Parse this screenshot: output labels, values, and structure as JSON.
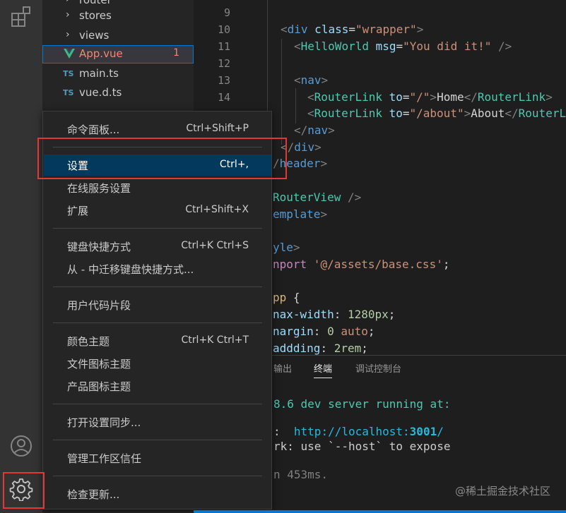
{
  "sidebar": {
    "items": [
      {
        "label": "router",
        "type": "folder"
      },
      {
        "label": "stores",
        "type": "folder"
      },
      {
        "label": "views",
        "type": "folder"
      },
      {
        "label": "App.vue",
        "type": "vue",
        "badge": "1"
      },
      {
        "label": "main.ts",
        "type": "ts",
        "icon_text": "TS"
      },
      {
        "label": "vue.d.ts",
        "type": "ts",
        "icon_text": "TS"
      }
    ]
  },
  "editor": {
    "line_numbers": [
      "9",
      "10",
      "11",
      "12",
      "13",
      "14"
    ],
    "code": {
      "l10": {
        "open": "<",
        "tag": "div",
        "attr": " class",
        "eq": "=",
        "str": "\"wrapper\"",
        "close": ">"
      },
      "l11": {
        "open": "<",
        "tag": "HelloWorld",
        "attr": " msg",
        "eq": "=",
        "str": "\"You did it!\"",
        "close": " />"
      },
      "l13": {
        "open": "<",
        "tag": "nav",
        "close": ">"
      },
      "l14": {
        "open": "<",
        "tag": "RouterLink",
        "attr": " to",
        "eq": "=",
        "str": "\"/\"",
        "gt": ">",
        "text": "Home",
        "endopen": "</",
        "endtag": "RouterLink",
        "endclose": ">"
      },
      "l15": {
        "open": "<",
        "tag": "RouterLink",
        "attr": " to",
        "eq": "=",
        "str": "\"/about\"",
        "gt": ">",
        "text": "About",
        "endopen": "</",
        "endtag": "RouterL"
      },
      "l16": {
        "open": "</",
        "tag": "nav",
        "close": ">"
      },
      "l17": {
        "open": "</",
        "tag": "div",
        "close": ">"
      },
      "l18": {
        "open": "/",
        "tag": "header",
        "close": ">"
      },
      "l20": {
        "comp": "RouterView",
        "close": " />"
      },
      "l21": {
        "tag": "emplate",
        "close": ">"
      },
      "l23": {
        "tag": "yle",
        "close": ">"
      },
      "l24": {
        "kw": "nport",
        "str": " '@/assets/base.css'",
        "semi": ";"
      },
      "l26": {
        "sel": "pp",
        "brace": " {"
      },
      "l27": {
        "prop": "nax-width",
        "colon": ": ",
        "num": "1280px",
        "semi": ";"
      },
      "l28": {
        "prop": "nargin",
        "colon": ": ",
        "num": "0",
        "val": " auto",
        "semi": ";"
      },
      "l29": {
        "prop": "addding",
        "colon": ": ",
        "num": "2rem",
        "semi": ";"
      }
    }
  },
  "panel": {
    "tabs": [
      {
        "label": "输出",
        "active": false
      },
      {
        "label": "终端",
        "active": true
      },
      {
        "label": "调试控制台",
        "active": false
      }
    ],
    "terminal": {
      "line1": "8.6 dev server running at:",
      "line2_prefix": ":  ",
      "line2_url": "http://localhost:",
      "line2_port": "3001",
      "line2_slash": "/",
      "line3": "rk: use `--host` to expose",
      "line4": "n 453ms."
    },
    "watermark": "@稀土掘金技术社区"
  },
  "menu": {
    "items": [
      {
        "label": "命令面板...",
        "shortcut": "Ctrl+Shift+P"
      },
      {
        "label": "设置",
        "shortcut": "Ctrl+,",
        "active": true
      },
      {
        "label": "在线服务设置",
        "shortcut": ""
      },
      {
        "label": "扩展",
        "shortcut": "Ctrl+Shift+X"
      },
      {
        "label": "键盘快捷方式",
        "shortcut": "Ctrl+K Ctrl+S"
      },
      {
        "label": "从 - 中迁移键盘快捷方式...",
        "shortcut": ""
      },
      {
        "label": "用户代码片段",
        "shortcut": ""
      },
      {
        "label": "颜色主题",
        "shortcut": "Ctrl+K Ctrl+T"
      },
      {
        "label": "文件图标主题",
        "shortcut": ""
      },
      {
        "label": "产品图标主题",
        "shortcut": ""
      },
      {
        "label": "打开设置同步...",
        "shortcut": ""
      },
      {
        "label": "管理工作区信任",
        "shortcut": ""
      },
      {
        "label": "检查更新...",
        "shortcut": ""
      }
    ]
  },
  "activity_bar": {
    "icons": [
      "extensions-icon",
      "account-icon",
      "gear-icon"
    ]
  },
  "colors": {
    "accent": "#0078d4",
    "highlight_box": "#e0393a",
    "menu_active": "#04395e"
  }
}
